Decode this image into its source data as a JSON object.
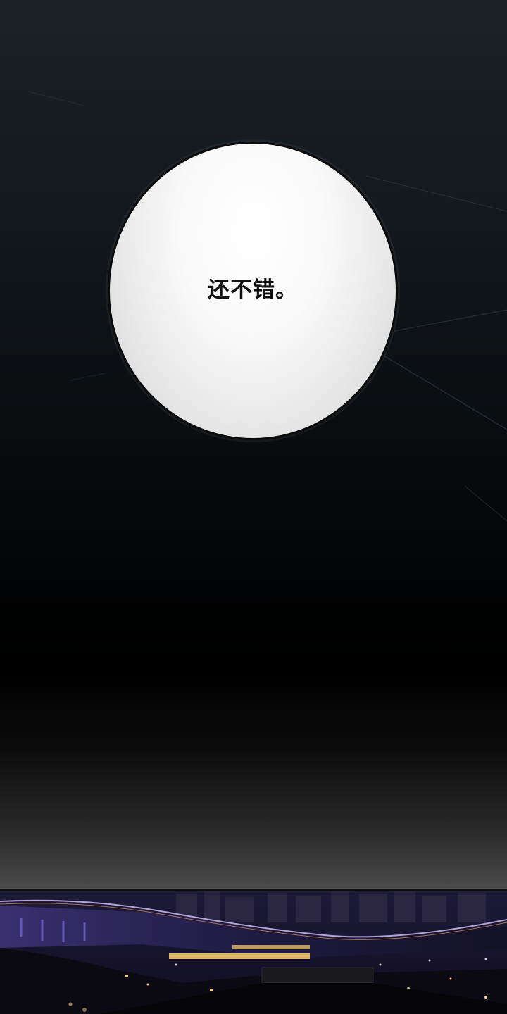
{
  "dialogue": {
    "text": "还不错。"
  },
  "scene": {
    "bottom_panel": "night-city-illustration"
  },
  "colors": {
    "background_top": "#1b2227",
    "background_mid": "#000000",
    "background_bottom_fade": "#4a4a4a",
    "bubble_fill": "#ffffff",
    "bubble_outline": "#0b0b0b",
    "text": "#111111"
  }
}
